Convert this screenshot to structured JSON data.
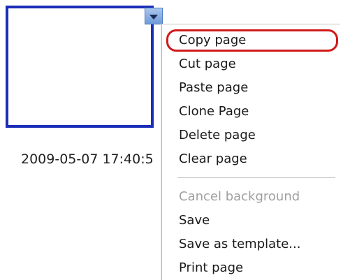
{
  "thumbnail": {
    "border_color": "#1c2db8",
    "dropdown_icon": "chevron-down-icon",
    "timestamp": "2009-05-07 17:40:5"
  },
  "context_menu": {
    "items": [
      {
        "label": "Copy page",
        "enabled": true,
        "highlighted": true
      },
      {
        "label": "Cut page",
        "enabled": true
      },
      {
        "label": "Paste page",
        "enabled": true
      },
      {
        "label": "Clone Page",
        "enabled": true
      },
      {
        "label": "Delete page",
        "enabled": true
      },
      {
        "label": "Clear page",
        "enabled": true
      },
      {
        "label": "Cancel background",
        "enabled": false
      },
      {
        "label": "Save",
        "enabled": true
      },
      {
        "label": "Save as template...",
        "enabled": true
      },
      {
        "label": "Print page",
        "enabled": true
      }
    ],
    "highlight_color": "#d11a1a"
  }
}
